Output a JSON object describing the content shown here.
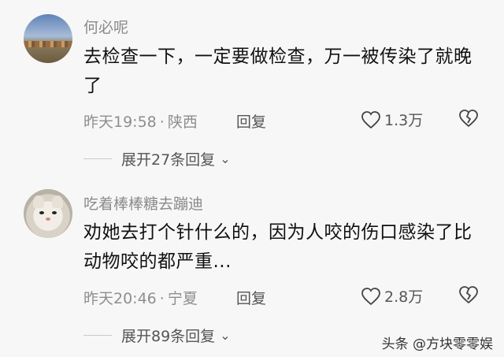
{
  "comments": [
    {
      "username": "何必呢",
      "text": "去检查一下，一定要做检查，万一被传染了就晚了",
      "time": "昨天19:58",
      "location": "陕西",
      "reply_label": "回复",
      "likes": "1.3万",
      "expand_label": "展开27条回复",
      "avatar_icon": "avatar-landscape",
      "like_icon": "heart-outline-icon",
      "dislike_icon": "broken-heart-icon"
    },
    {
      "username": "吃着棒棒糖去蹦迪",
      "text": "劝她去打个针什么的，因为人咬的伤口感染了比动物咬的都严重...",
      "time": "昨天20:46",
      "location": "宁夏",
      "reply_label": "回复",
      "likes": "2.8万",
      "expand_label": "展开89条回复",
      "avatar_icon": "avatar-cat",
      "like_icon": "heart-outline-icon",
      "dislike_icon": "broken-heart-icon"
    }
  ],
  "meta_separator": "·",
  "watermark": "头条 @方块零零娱",
  "colors": {
    "background": "#f7f7f7",
    "username": "#8a8a8a",
    "meta": "#8e8e8e",
    "text": "#111111"
  }
}
